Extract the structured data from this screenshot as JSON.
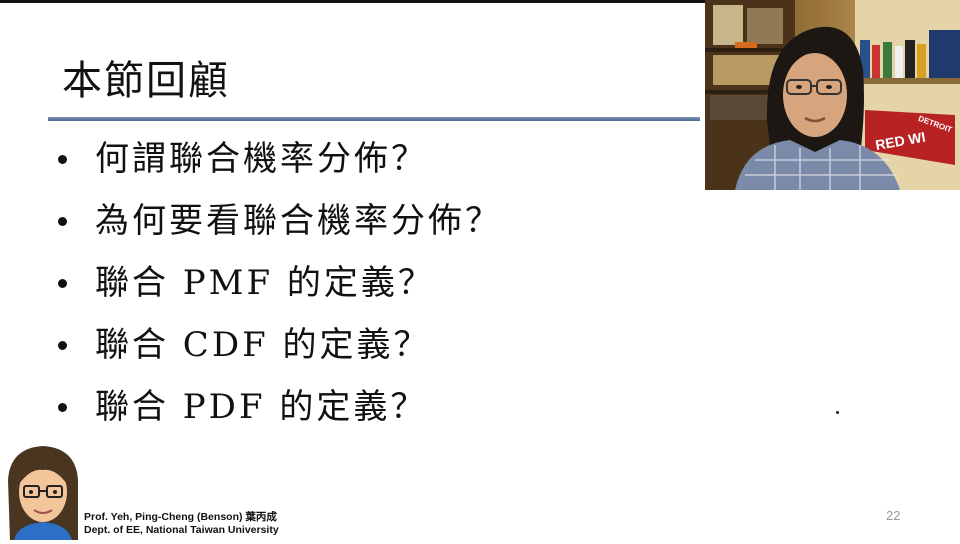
{
  "slide": {
    "title": "本節回顧",
    "bullets": [
      "何謂聯合機率分佈？",
      "為何要看聯合機率分佈？",
      "聯合 PMF 的定義？",
      "聯合 CDF 的定義？",
      "聯合 PDF 的定義？"
    ],
    "page_number": "22"
  },
  "footer": {
    "line1": "Prof. Yeh, Ping-Cheng (Benson) 葉丙成",
    "line2": "Dept. of EE,  National Taiwan University"
  },
  "webcam": {
    "pennant_text": "RED WI",
    "pennant_text2": "DETROIT"
  },
  "colors": {
    "rule": "#4a6591",
    "text": "#111111"
  }
}
